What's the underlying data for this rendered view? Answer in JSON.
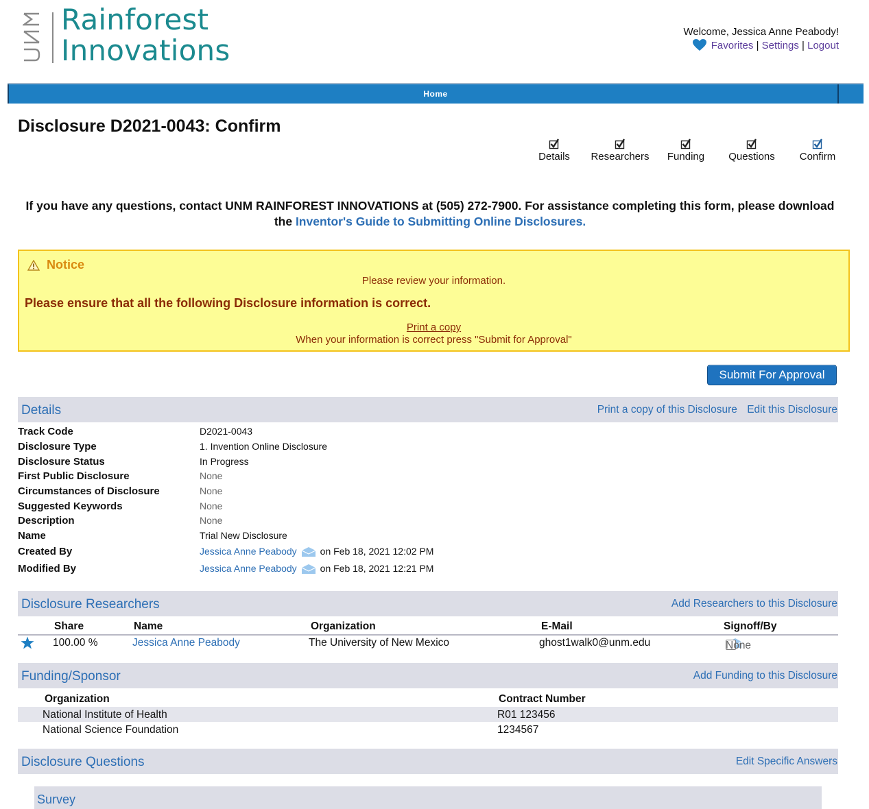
{
  "header": {
    "logo_line1": "Rainforest",
    "logo_line2": "Innovations",
    "welcome": "Welcome, Jessica Anne Peabody!",
    "favorites": "Favorites",
    "settings": "Settings",
    "logout": "Logout",
    "separator": "|"
  },
  "nav": {
    "home": "Home"
  },
  "page": {
    "title": "Disclosure D2021-0043: Confirm"
  },
  "steps": [
    {
      "label": "Details",
      "checked": true
    },
    {
      "label": "Researchers",
      "checked": true
    },
    {
      "label": "Funding",
      "checked": true
    },
    {
      "label": "Questions",
      "checked": true
    },
    {
      "label": "Confirm",
      "checked": true
    }
  ],
  "contact": {
    "text": "If you have any questions, contact UNM RAINFOREST INNOVATIONS at (505) 272-7900. For assistance completing this form, please download the ",
    "link": "Inventor's Guide to Submitting Online Disclosures."
  },
  "notice": {
    "heading": "Notice",
    "review": "Please review your information.",
    "strong": "Please ensure that all the following Disclosure information is correct.",
    "print_link": "Print a copy",
    "instruction": "When your information is correct press \"Submit for Approval\""
  },
  "submit_button": "Submit For Approval",
  "details": {
    "title": "Details",
    "print_link": "Print a copy of this Disclosure",
    "edit_link": "Edit this Disclosure",
    "rows": [
      {
        "label": "Track Code",
        "value": "D2021-0043"
      },
      {
        "label": "Disclosure Type",
        "value": "1. Invention Online Disclosure"
      },
      {
        "label": "Disclosure Status",
        "value": "In Progress"
      },
      {
        "label": "First Public Disclosure",
        "value": "None"
      },
      {
        "label": "Circumstances of Disclosure",
        "value": "None"
      },
      {
        "label": "Suggested Keywords",
        "value": "None"
      },
      {
        "label": "Description",
        "value": "None"
      },
      {
        "label": "Name",
        "value": "Trial New Disclosure"
      }
    ],
    "created_by": {
      "label": "Created By",
      "person": "Jessica Anne Peabody",
      "when": "on Feb 18, 2021 12:02 PM"
    },
    "modified_by": {
      "label": "Modified By",
      "person": "Jessica Anne Peabody",
      "when": "on Feb 18, 2021 12:21 PM"
    }
  },
  "researchers": {
    "title": "Disclosure Researchers",
    "add_link": "Add Researchers to this Disclosure",
    "columns": [
      "Share",
      "Name",
      "Organization",
      "E-Mail",
      "Signoff/By"
    ],
    "rows": [
      {
        "share": "100.00 %",
        "name": "Jessica Anne Peabody",
        "organization": "The University of New Mexico",
        "email": "ghost1walk0@unm.edu",
        "signoff": "None"
      }
    ]
  },
  "funding": {
    "title": "Funding/Sponsor",
    "add_link": "Add Funding to this Disclosure",
    "columns": [
      "Organization",
      "Contract Number"
    ],
    "rows": [
      {
        "organization": "National Institute of Health",
        "contract": "R01 123456"
      },
      {
        "organization": "National Science Foundation",
        "contract": "1234567"
      }
    ]
  },
  "questions": {
    "title": "Disclosure Questions",
    "edit_link": "Edit Specific Answers",
    "survey": "Survey"
  },
  "colors": {
    "teal": "#1b8a8f",
    "nav_blue": "#1e7fc3",
    "link_blue": "#2d6fb5",
    "notice_bg": "#fdfd96",
    "notice_border": "#f3c21d"
  }
}
